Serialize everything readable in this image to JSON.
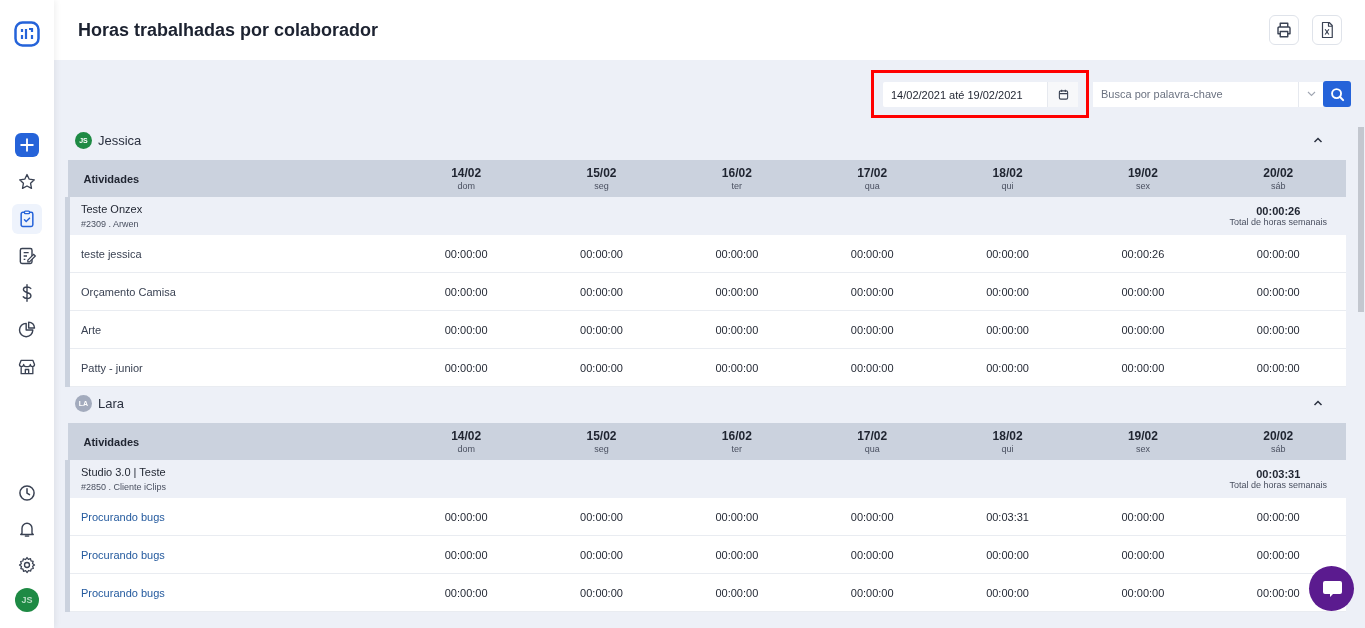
{
  "sidebar": {
    "items": [
      {
        "kind": "star",
        "selected": false
      },
      {
        "kind": "clipboard",
        "selected": true
      },
      {
        "kind": "note",
        "selected": false
      },
      {
        "kind": "dollar",
        "selected": false
      },
      {
        "kind": "pie",
        "selected": false
      },
      {
        "kind": "store",
        "selected": false
      }
    ],
    "bottom_items": [
      {
        "kind": "clock"
      },
      {
        "kind": "bell"
      },
      {
        "kind": "gear"
      }
    ],
    "user_initials": "JS"
  },
  "header": {
    "title": "Horas trabalhadas por colaborador"
  },
  "filters": {
    "date_range": "14/02/2021 até 19/02/2021",
    "search": {
      "placeholder": "Busca por palavra-chave"
    }
  },
  "groups": [
    {
      "name": "Jessica",
      "initials": "JS",
      "color": "#1e8a44",
      "expanded": true,
      "columns": [
        {
          "date": "Atividades"
        },
        {
          "date": "14/02",
          "day": "dom"
        },
        {
          "date": "15/02",
          "day": "seg"
        },
        {
          "date": "16/02",
          "day": "ter"
        },
        {
          "date": "17/02",
          "day": "qua"
        },
        {
          "date": "18/02",
          "day": "qui"
        },
        {
          "date": "19/02",
          "day": "sex"
        },
        {
          "date": "20/02",
          "day": "sáb"
        }
      ],
      "project": {
        "name": "Teste Onzex",
        "meta": "#2309 . Arwen",
        "total": "00:00:26",
        "total_label": "Total de horas semanais"
      },
      "rows": [
        {
          "activity": "teste jessica",
          "linked": false,
          "hours": [
            "00:00:00",
            "00:00:00",
            "00:00:00",
            "00:00:00",
            "00:00:00",
            "00:00:26",
            "00:00:00"
          ]
        },
        {
          "activity": "Orçamento Camisa",
          "linked": false,
          "hours": [
            "00:00:00",
            "00:00:00",
            "00:00:00",
            "00:00:00",
            "00:00:00",
            "00:00:00",
            "00:00:00"
          ]
        },
        {
          "activity": "Arte",
          "linked": false,
          "hours": [
            "00:00:00",
            "00:00:00",
            "00:00:00",
            "00:00:00",
            "00:00:00",
            "00:00:00",
            "00:00:00"
          ]
        },
        {
          "activity": "Patty - junior",
          "linked": false,
          "hours": [
            "00:00:00",
            "00:00:00",
            "00:00:00",
            "00:00:00",
            "00:00:00",
            "00:00:00",
            "00:00:00"
          ]
        }
      ]
    },
    {
      "name": "Lara",
      "initials": "LA",
      "color": "#a3abbd",
      "expanded": true,
      "columns": [
        {
          "date": "Atividades"
        },
        {
          "date": "14/02",
          "day": "dom"
        },
        {
          "date": "15/02",
          "day": "seg"
        },
        {
          "date": "16/02",
          "day": "ter"
        },
        {
          "date": "17/02",
          "day": "qua"
        },
        {
          "date": "18/02",
          "day": "qui"
        },
        {
          "date": "19/02",
          "day": "sex"
        },
        {
          "date": "20/02",
          "day": "sáb"
        }
      ],
      "project": {
        "name": "Studio 3.0 | Teste",
        "meta": "#2850 . Cliente iClips",
        "total": "00:03:31",
        "total_label": "Total de horas semanais"
      },
      "rows": [
        {
          "activity": "Procurando bugs",
          "linked": true,
          "hours": [
            "00:00:00",
            "00:00:00",
            "00:00:00",
            "00:00:00",
            "00:03:31",
            "00:00:00",
            "00:00:00"
          ]
        },
        {
          "activity": "Procurando bugs",
          "linked": true,
          "hours": [
            "00:00:00",
            "00:00:00",
            "00:00:00",
            "00:00:00",
            "00:00:00",
            "00:00:00",
            "00:00:00"
          ]
        },
        {
          "activity": "Procurando bugs",
          "linked": true,
          "hours": [
            "00:00:00",
            "00:00:00",
            "00:00:00",
            "00:00:00",
            "00:00:00",
            "00:00:00",
            "00:00:00"
          ]
        }
      ]
    }
  ]
}
